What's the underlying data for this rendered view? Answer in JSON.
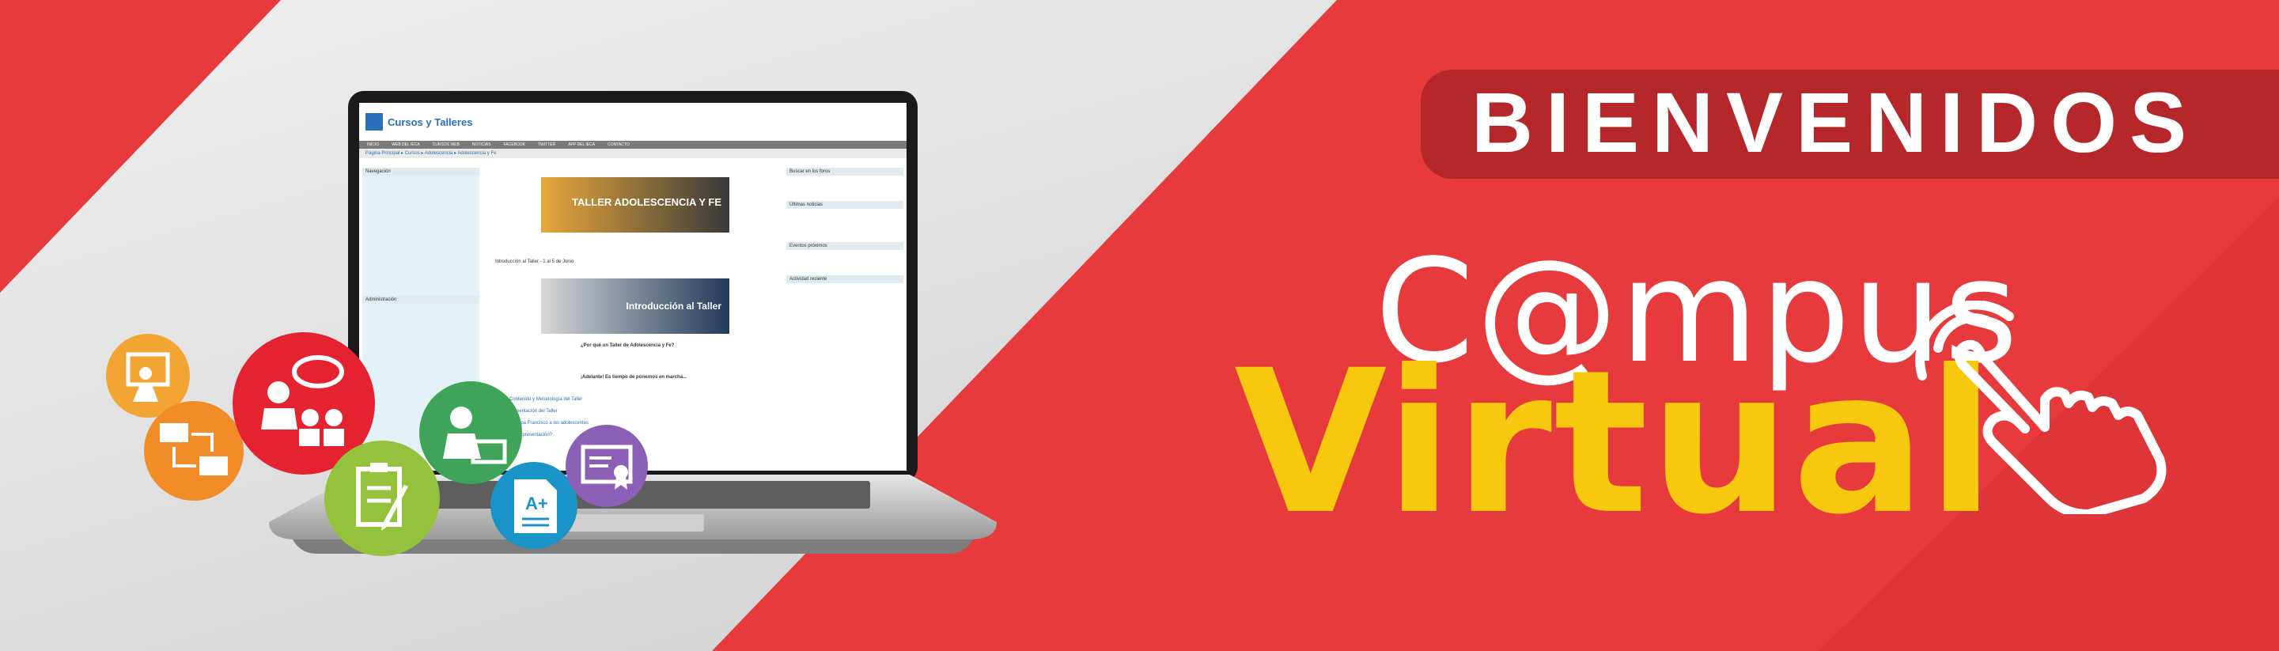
{
  "banner": {
    "welcome": "BIENVENIDOS",
    "campus": "C@mpus",
    "virtual": "Virtual"
  },
  "colors": {
    "red": "#e63a3c",
    "dark_red": "#b5272b",
    "yellow": "#f8c80e",
    "white": "#ffffff"
  },
  "moodle": {
    "site_title": "Cursos y Talleres",
    "nav": [
      "INICIO",
      "WEB DEL IECA",
      "CURSOS WEB",
      "NOTICIAS",
      "FACEBOOK",
      "TWITTER",
      "APP DEL IECA",
      "CONTACTO"
    ],
    "breadcrumb": "Página Principal ▸ Cursos ▸ Adolescencia ▸ Adolescencia y Fe",
    "left_blocks": {
      "navigation": "Navegación",
      "admin": "Administración"
    },
    "right_blocks": {
      "search": "Buscar en los foros",
      "news": "Últimas noticias",
      "events": "Eventos próximos",
      "activity": "Actividad reciente"
    },
    "banner1": "TALLER ADOLESCENCIA Y FE",
    "banner2": "Introducción al Taller",
    "section_title": "Introducción al Taller - 1 al 5 de Junio",
    "question": "¿Por qué un Taller de Adolescencia y Fe?",
    "links": [
      "Contenido y Metodología del Taller",
      "Presentación del Taller",
      "El Papa Francisco a los adolescentes",
      "¿Una presentación?"
    ],
    "closing": "¡Adelante! Es tiempo de ponernos en marcha..."
  },
  "icons": [
    "teacher-icon",
    "presentation-group-icon",
    "network-computers-icon",
    "student-laptop-icon",
    "clipboard-pencil-icon",
    "graded-document-icon",
    "certificate-icon",
    "pointing-hand-icon"
  ]
}
